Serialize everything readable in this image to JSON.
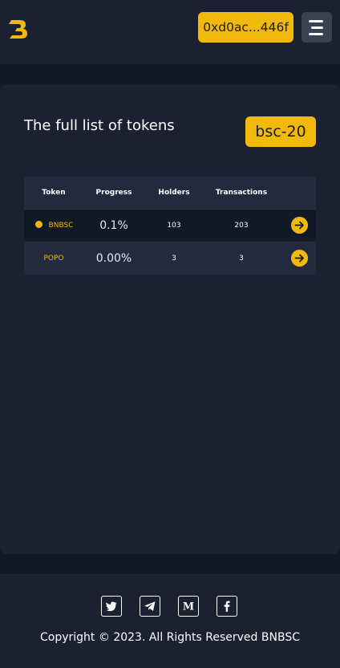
{
  "header": {
    "logo_icon": "bnbsc-logo",
    "wallet_address": "0xd0ac...446f",
    "menu_icon": "hamburger-menu-icon"
  },
  "main": {
    "title": "The full list of tokens",
    "standard_badge": "bsc-20",
    "table": {
      "columns": [
        "Token",
        "Progress",
        "Holders",
        "Transactions"
      ],
      "rows": [
        {
          "token": "BNBSC",
          "progress": "0.1%",
          "holders": "103",
          "transactions": "203",
          "has_dot": true
        },
        {
          "token": "POPO",
          "progress": "0.00%",
          "holders": "3",
          "transactions": "3",
          "has_dot": false
        }
      ]
    }
  },
  "footer": {
    "social_icons": [
      "twitter-icon",
      "telegram-icon",
      "medium-icon",
      "facebook-icon"
    ],
    "copyright": "Copyright © 2023. All Rights Reserved BNBSC"
  },
  "colors": {
    "accent": "#f0b90b",
    "background": "#111826",
    "panel": "#1b2130",
    "table_header": "#232a3d"
  }
}
